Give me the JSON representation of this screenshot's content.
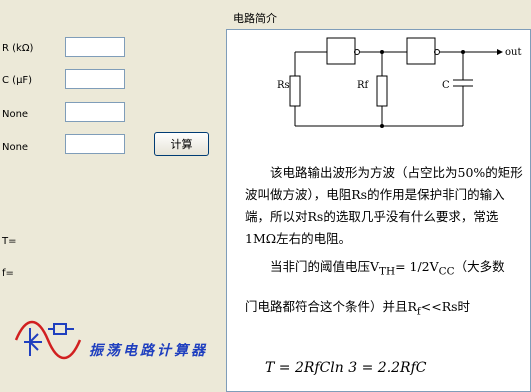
{
  "inputs": {
    "r_label": "R (kΩ)",
    "c_label": "C (μF)",
    "none1_label": "None",
    "none2_label": "None",
    "r_value": "",
    "c_value": "",
    "none1_value": "",
    "none2_value": ""
  },
  "calc_button": "计算",
  "results": {
    "t_label": "T=",
    "f_label": "f="
  },
  "logo": {
    "text": "振荡电路计算器"
  },
  "panel": {
    "title": "电路简介",
    "circuit": {
      "rs": "Rs",
      "rf": "Rf",
      "c": "C",
      "out": "out"
    },
    "para1": "该电路输出波形为方波（占空比为50%的矩形波叫做方波），电阻Rs的作用是保护非门的输入端，所以对Rs的选取几乎没有什么要求，常选1MΩ左右的电阻。",
    "para2_part1": "当非门的阈值电压V",
    "para2_sub1": "TH",
    "para2_part2": "= 1/2V",
    "para2_sub2": "CC",
    "para2_part3": "（大多数",
    "para3_part1": "门电路都符合这个条件）并且R",
    "para3_sub": "f",
    "para3_part2": "<<Rs时",
    "formula": "T = 2RfCln 3 = 2.2RfC"
  }
}
